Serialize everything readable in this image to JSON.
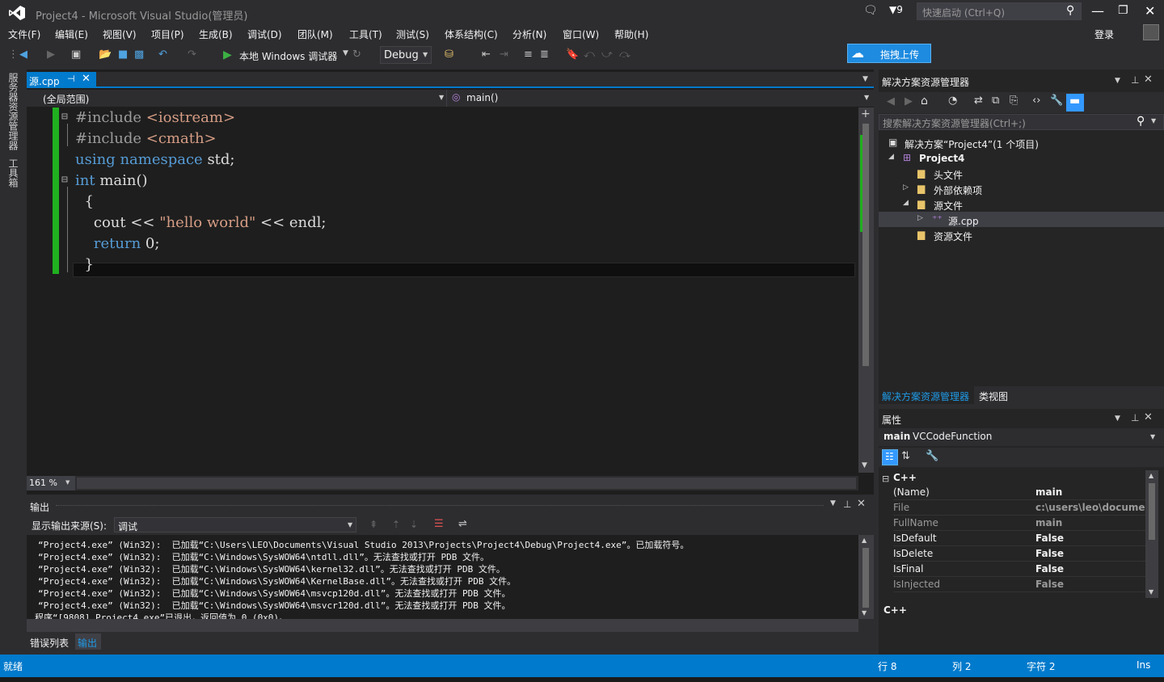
{
  "window": {
    "title": "Project4 - Microsoft Visual Studio(管理员)",
    "notifications": "9",
    "quick_launch_placeholder": "快速启动 (Ctrl+Q)",
    "login": "登录"
  },
  "menu": [
    "文件(F)",
    "编辑(E)",
    "视图(V)",
    "项目(P)",
    "生成(B)",
    "调试(D)",
    "团队(M)",
    "工具(T)",
    "测试(S)",
    "体系结构(C)",
    "分析(N)",
    "窗口(W)",
    "帮助(H)"
  ],
  "toolbar": {
    "run_label": "本地 Windows 调试器",
    "config": "Debug",
    "upload": "拖拽上传"
  },
  "left_strip": [
    "服务器资源管理器",
    "工具箱"
  ],
  "editor": {
    "tab": "源.cpp",
    "scope": "(全局范围)",
    "member": "main()",
    "zoom": "161 %",
    "lines": [
      {
        "parts": [
          {
            "t": "#include ",
            "c": "pp"
          },
          {
            "t": "<iostream>",
            "c": "str"
          }
        ]
      },
      {
        "parts": [
          {
            "t": "#include ",
            "c": "pp"
          },
          {
            "t": "<cmath>",
            "c": "str"
          }
        ]
      },
      {
        "parts": [
          {
            "t": "using ",
            "c": "kw"
          },
          {
            "t": "namespace ",
            "c": "kw"
          },
          {
            "t": "std;",
            "c": ""
          }
        ]
      },
      {
        "parts": [
          {
            "t": "int ",
            "c": "kw"
          },
          {
            "t": "main()",
            "c": ""
          }
        ]
      },
      {
        "parts": [
          {
            "t": "  {",
            "c": ""
          }
        ]
      },
      {
        "parts": [
          {
            "t": "    cout << ",
            "c": ""
          },
          {
            "t": "\"hello world\"",
            "c": "str"
          },
          {
            "t": " << endl;",
            "c": ""
          }
        ]
      },
      {
        "parts": [
          {
            "t": "    ",
            "c": ""
          },
          {
            "t": "return ",
            "c": "kw"
          },
          {
            "t": "0;",
            "c": ""
          }
        ]
      },
      {
        "parts": [
          {
            "t": "  }",
            "c": ""
          }
        ]
      }
    ]
  },
  "output": {
    "title": "输出",
    "source_label": "显示输出来源(S):",
    "source_value": "调试",
    "lines": [
      "“Project4.exe” (Win32):  已加载“C:\\Users\\LEO\\Documents\\Visual Studio 2013\\Projects\\Project4\\Debug\\Project4.exe”。已加载符号。",
      "“Project4.exe” (Win32):  已加载“C:\\Windows\\SysWOW64\\ntdll.dll”。无法查找或打开 PDB 文件。",
      "“Project4.exe” (Win32):  已加载“C:\\Windows\\SysWOW64\\kernel32.dll”。无法查找或打开 PDB 文件。",
      "“Project4.exe” (Win32):  已加载“C:\\Windows\\SysWOW64\\KernelBase.dll”。无法查找或打开 PDB 文件。",
      "“Project4.exe” (Win32):  已加载“C:\\Windows\\SysWOW64\\msvcp120d.dll”。无法查找或打开 PDB 文件。",
      "“Project4.exe” (Win32):  已加载“C:\\Windows\\SysWOW64\\msvcr120d.dll”。无法查找或打开 PDB 文件。",
      "程序“[9808] Project4.exe”已退出，返回值为 0 (0x0)。"
    ],
    "tabs": [
      "错误列表",
      "输出"
    ]
  },
  "solution": {
    "title": "解决方案资源管理器",
    "search_placeholder": "搜索解决方案资源管理器(Ctrl+;)",
    "items": [
      {
        "label": "解决方案“Project4”(1 个项目)",
        "icon": "solution-icon",
        "bold": false
      },
      {
        "label": "Project4",
        "icon": "project-icon",
        "bold": true
      },
      {
        "label": "头文件",
        "icon": "folder-icon",
        "bold": false
      },
      {
        "label": "外部依赖项",
        "icon": "folder-icon",
        "bold": false
      },
      {
        "label": "源文件",
        "icon": "folder-open-icon",
        "bold": false
      },
      {
        "label": "源.cpp",
        "icon": "cpp-file-icon",
        "bold": false
      },
      {
        "label": "资源文件",
        "icon": "folder-icon",
        "bold": false
      }
    ],
    "tabs": [
      "解决方案资源管理器",
      "类视图"
    ]
  },
  "properties": {
    "title": "属性",
    "object": "main",
    "object_type": "VCCodeFunction",
    "category": "C++",
    "rows": [
      {
        "name": "(Name)",
        "value": "main"
      },
      {
        "name": "File",
        "value": "c:\\users\\leo\\documents\\"
      },
      {
        "name": "FullName",
        "value": "main"
      },
      {
        "name": "IsDefault",
        "value": "False"
      },
      {
        "name": "IsDelete",
        "value": "False"
      },
      {
        "name": "IsFinal",
        "value": "False"
      },
      {
        "name": "IsInjected",
        "value": "False"
      }
    ],
    "description": "C++"
  },
  "status": {
    "ready": "就绪",
    "row": "行 8",
    "col": "列 2",
    "char": "字符 2",
    "mode": "Ins"
  },
  "colors": {
    "accent": "#007acc",
    "bg": "#2d2d30",
    "editor": "#1e1e1e",
    "changebar": "#20b020"
  }
}
